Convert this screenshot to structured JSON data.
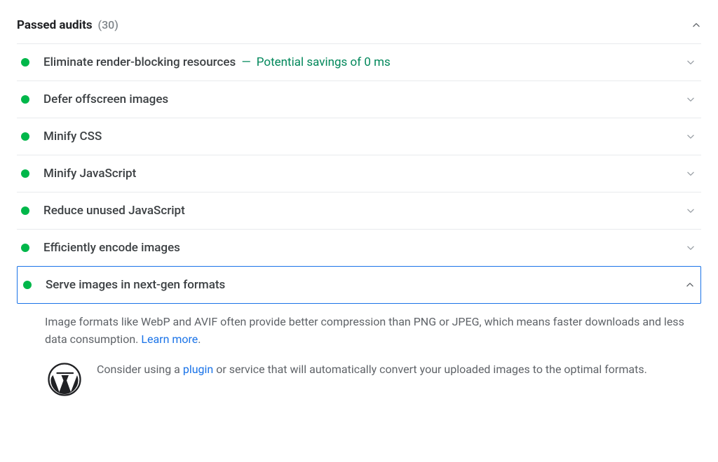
{
  "header": {
    "title": "Passed audits",
    "count": "(30)"
  },
  "audits": [
    {
      "title": "Eliminate render-blocking resources",
      "savings": "Potential savings of 0 ms",
      "expanded": false
    },
    {
      "title": "Defer offscreen images",
      "expanded": false
    },
    {
      "title": "Minify CSS",
      "expanded": false
    },
    {
      "title": "Minify JavaScript",
      "expanded": false
    },
    {
      "title": "Reduce unused JavaScript",
      "expanded": false
    },
    {
      "title": "Efficiently encode images",
      "expanded": false
    },
    {
      "title": "Serve images in next-gen formats",
      "expanded": true
    }
  ],
  "detail": {
    "description_pre": "Image formats like WebP and AVIF often provide better compression than PNG or JPEG, which means faster downloads and less data consumption. ",
    "learn_more_label": "Learn more",
    "description_post": ".",
    "wp_pre": "Consider using a ",
    "wp_link_label": "plugin",
    "wp_post": " or service that will automatically convert your uploaded images to the optimal formats."
  },
  "separator": "—"
}
